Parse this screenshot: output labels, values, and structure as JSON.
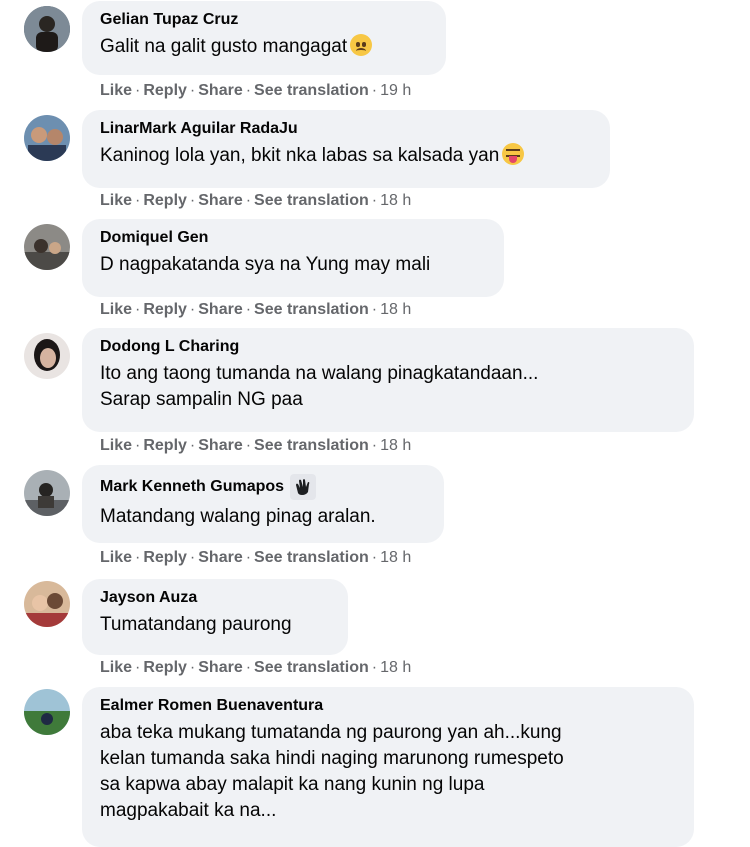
{
  "actions": {
    "like": "Like",
    "reply": "Reply",
    "share": "Share",
    "translate": "See translation",
    "sep": "·"
  },
  "comments": [
    {
      "author": "Gelian Tupaz Cruz",
      "text": "Galit na galit gusto mangagat",
      "emoji": "sad-face-icon",
      "time": "19 h"
    },
    {
      "author": "LinarMark Aguilar RadaJu",
      "text": "Kaninog lola yan, bkit nka labas sa kalsada yan",
      "emoji": "tongue-face-icon",
      "time": "18 h"
    },
    {
      "author": "Domiquel Gen",
      "text": "D nagpakatanda sya na Yung may mali",
      "time": "18 h"
    },
    {
      "author": "Dodong L Charing",
      "text": "Ito ang taong tumanda na walang pinagkatandaan...\nSarap sampalin NG paa",
      "time": "18 h"
    },
    {
      "author": "Mark Kenneth Gumapos",
      "badge": "clapping-hands-badge-icon",
      "text": "Matandang walang pinag aralan.",
      "time": "18 h"
    },
    {
      "author": "Jayson Auza",
      "text": "Tumatandang paurong",
      "time": "18 h"
    },
    {
      "author": "Ealmer Romen Buenaventura",
      "text": "aba teka mukang tumatanda ng paurong yan ah...kung\nkelan tumanda saka hindi naging marunong rumespeto\nsa kapwa abay malapit ka nang kunin ng lupa\nmagpakabait ka na..."
    }
  ],
  "colors": {
    "bubble": "#f0f2f5",
    "meta": "#65676b",
    "text": "#050505"
  }
}
